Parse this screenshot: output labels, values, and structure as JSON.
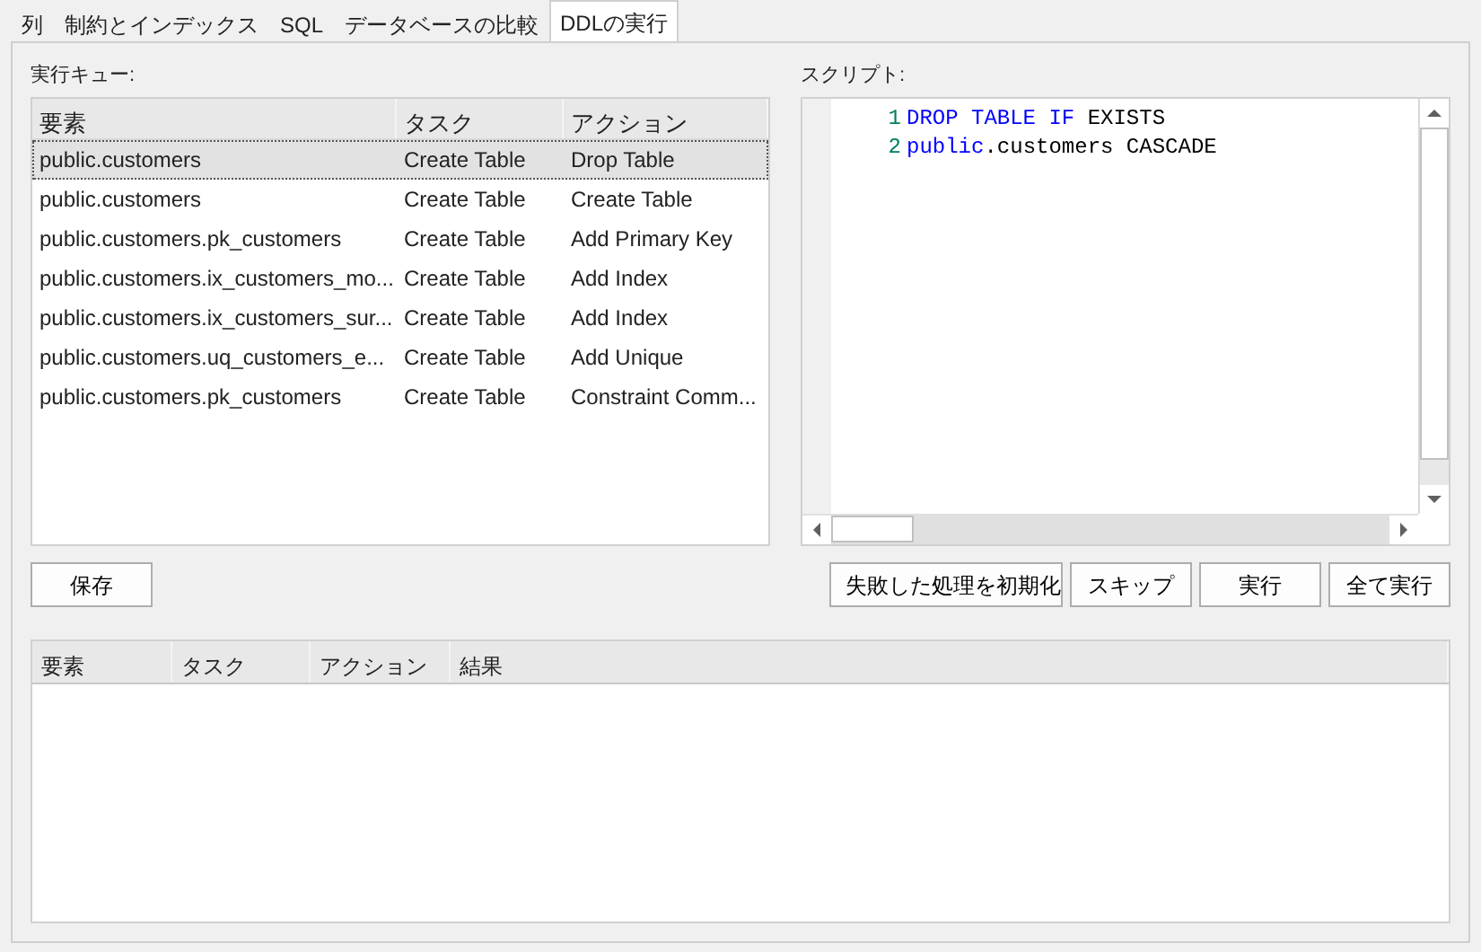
{
  "tabs": [
    {
      "label": "列",
      "selected": false
    },
    {
      "label": "制約とインデックス",
      "selected": false
    },
    {
      "label": "SQL",
      "selected": false
    },
    {
      "label": "データベースの比較",
      "selected": false
    },
    {
      "label": "DDLの実行",
      "selected": true
    }
  ],
  "queue": {
    "label": "実行キュー:",
    "columns": [
      "要素",
      "タスク",
      "アクション"
    ],
    "rows": [
      {
        "cells": [
          "public.customers",
          "Create Table",
          "Drop Table"
        ],
        "selected": true
      },
      {
        "cells": [
          "public.customers",
          "Create Table",
          "Create Table"
        ],
        "selected": false
      },
      {
        "cells": [
          "public.customers.pk_customers",
          "Create Table",
          "Add Primary Key"
        ],
        "selected": false
      },
      {
        "cells": [
          "public.customers.ix_customers_mo...",
          "Create Table",
          "Add Index"
        ],
        "selected": false
      },
      {
        "cells": [
          "public.customers.ix_customers_sur...",
          "Create Table",
          "Add Index"
        ],
        "selected": false
      },
      {
        "cells": [
          "public.customers.uq_customers_e...",
          "Create Table",
          "Add Unique"
        ],
        "selected": false
      },
      {
        "cells": [
          "public.customers.pk_customers",
          "Create Table",
          "Constraint Comm..."
        ],
        "selected": false
      }
    ]
  },
  "save_button": "保存",
  "script": {
    "label": "スクリプト:",
    "lines": [
      {
        "number": "1",
        "tokens": [
          {
            "text": "DROP TABLE IF",
            "kind": "keyword"
          },
          {
            "text": " EXISTS",
            "kind": "plain"
          }
        ]
      },
      {
        "number": "2",
        "tokens": [
          {
            "text": "public",
            "kind": "keyword"
          },
          {
            "text": ".customers CASCADE",
            "kind": "plain"
          }
        ]
      }
    ]
  },
  "action_buttons": [
    "失敗した処理を初期化",
    "スキップ",
    "実行",
    "全て実行"
  ],
  "results": {
    "columns": [
      "要素",
      "タスク",
      "アクション",
      "結果"
    ]
  }
}
